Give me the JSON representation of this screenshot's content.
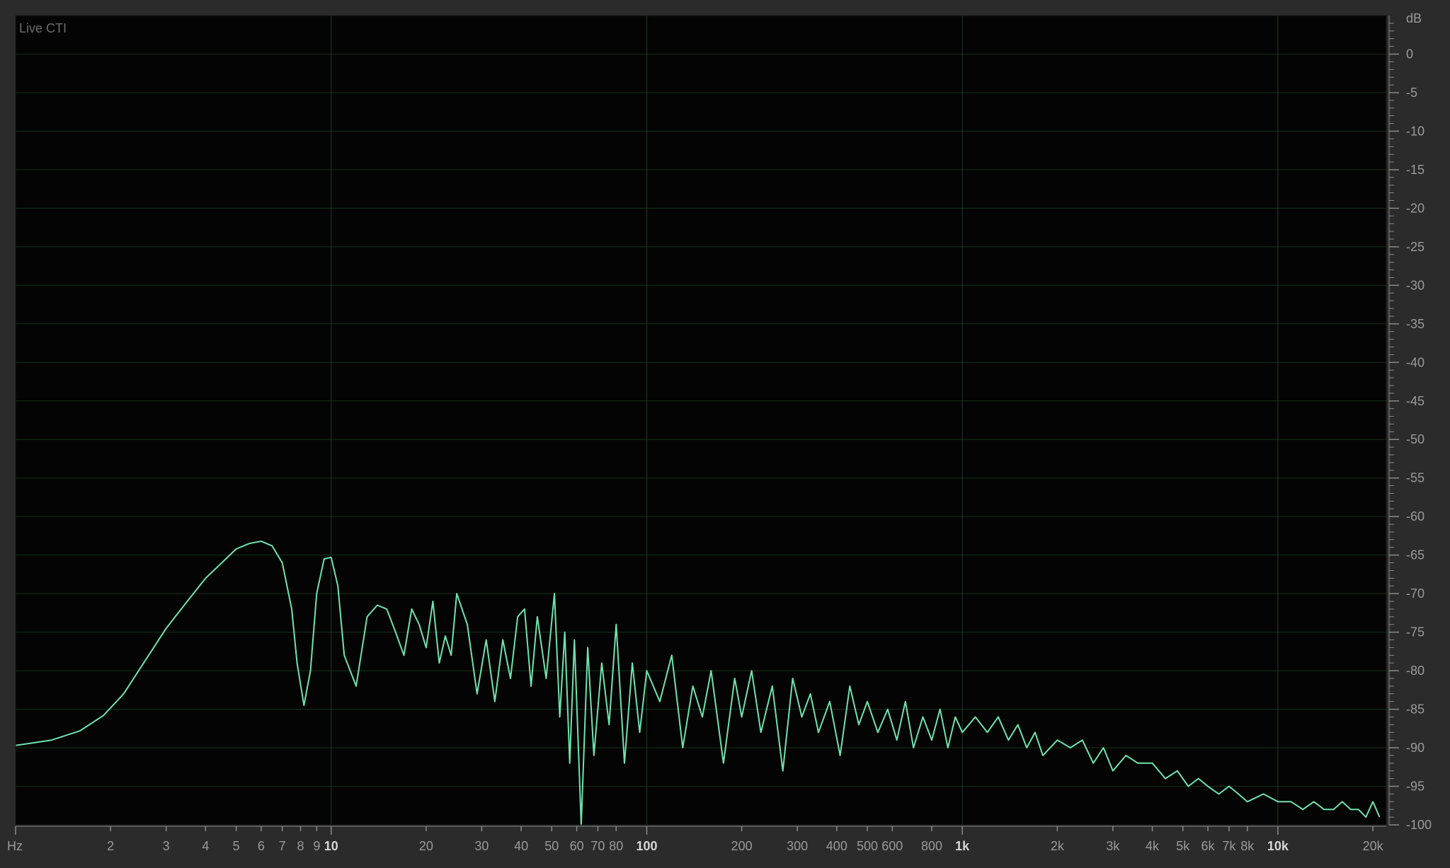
{
  "overlay_label": "Live CTI",
  "colors": {
    "background": "#2b2b2b",
    "plot_background": "#040404",
    "grid": "#16301c",
    "grid_major": "#1f3c25",
    "trace": "#6fe3ad",
    "tick": "#8a8a8a",
    "label": "#9a9a9a",
    "label_major": "#d6d6d6"
  },
  "chart_data": {
    "type": "line",
    "title": "",
    "xlabel": "Hz",
    "ylabel": "dB",
    "xscale": "log",
    "xlim": [
      1,
      22050
    ],
    "ylim": [
      -100,
      5
    ],
    "grid": true,
    "y_ticks": [
      0,
      -5,
      -10,
      -15,
      -20,
      -25,
      -30,
      -35,
      -40,
      -45,
      -50,
      -55,
      -60,
      -65,
      -70,
      -75,
      -80,
      -85,
      -90,
      -95,
      -100
    ],
    "x_ticks": [
      {
        "value": 2,
        "label": "2",
        "major": false
      },
      {
        "value": 3,
        "label": "3",
        "major": false
      },
      {
        "value": 4,
        "label": "4",
        "major": false
      },
      {
        "value": 5,
        "label": "5",
        "major": false
      },
      {
        "value": 6,
        "label": "6",
        "major": false
      },
      {
        "value": 7,
        "label": "7",
        "major": false
      },
      {
        "value": 8,
        "label": "8",
        "major": false
      },
      {
        "value": 9,
        "label": "9",
        "major": false
      },
      {
        "value": 10,
        "label": "10",
        "major": true
      },
      {
        "value": 20,
        "label": "20",
        "major": false
      },
      {
        "value": 30,
        "label": "30",
        "major": false
      },
      {
        "value": 40,
        "label": "40",
        "major": false
      },
      {
        "value": 50,
        "label": "50",
        "major": false
      },
      {
        "value": 60,
        "label": "60",
        "major": false
      },
      {
        "value": 70,
        "label": "70",
        "major": false
      },
      {
        "value": 80,
        "label": "80",
        "major": false
      },
      {
        "value": 100,
        "label": "100",
        "major": true
      },
      {
        "value": 200,
        "label": "200",
        "major": false
      },
      {
        "value": 300,
        "label": "300",
        "major": false
      },
      {
        "value": 400,
        "label": "400",
        "major": false
      },
      {
        "value": 500,
        "label": "500",
        "major": false
      },
      {
        "value": 600,
        "label": "600",
        "major": false
      },
      {
        "value": 800,
        "label": "800",
        "major": false
      },
      {
        "value": 1000,
        "label": "1k",
        "major": true
      },
      {
        "value": 2000,
        "label": "2k",
        "major": false
      },
      {
        "value": 3000,
        "label": "3k",
        "major": false
      },
      {
        "value": 4000,
        "label": "4k",
        "major": false
      },
      {
        "value": 5000,
        "label": "5k",
        "major": false
      },
      {
        "value": 6000,
        "label": "6k",
        "major": false
      },
      {
        "value": 7000,
        "label": "7k",
        "major": false
      },
      {
        "value": 8000,
        "label": "8k",
        "major": false
      },
      {
        "value": 10000,
        "label": "10k",
        "major": true
      },
      {
        "value": 20000,
        "label": "20k",
        "major": false
      }
    ],
    "series": [
      {
        "x": [
          1,
          1.3,
          1.6,
          1.9,
          2.2,
          2.5,
          3.0,
          3.5,
          4.0,
          4.5,
          5.0,
          5.5,
          6.0,
          6.5,
          7.0,
          7.5,
          7.8,
          8.2,
          8.6,
          9.0,
          9.5,
          10.0,
          10.5,
          11.0,
          12.0,
          13.0,
          14.0,
          15.0,
          16.0,
          17.0,
          18.0,
          19.0,
          20.0,
          21.0,
          22.0,
          23.0,
          24.0,
          25.0,
          27.0,
          29.0,
          31.0,
          33.0,
          35.0,
          37.0,
          39.0,
          41.0,
          43.0,
          45.0,
          48.0,
          51.0,
          53.0,
          55.0,
          57.0,
          59.0,
          62.0,
          65.0,
          68.0,
          72.0,
          76.0,
          80.0,
          85.0,
          90.0,
          95.0,
          100.0,
          110.0,
          120.0,
          130.0,
          140.0,
          150.0,
          160.0,
          175.0,
          190.0,
          200.0,
          215.0,
          230.0,
          250.0,
          270.0,
          290.0,
          310.0,
          330.0,
          350.0,
          380.0,
          410.0,
          440.0,
          470.0,
          500.0,
          540.0,
          580.0,
          620.0,
          660.0,
          700.0,
          750.0,
          800.0,
          850.0,
          900.0,
          950.0,
          1000.0,
          1100.0,
          1200.0,
          1300.0,
          1400.0,
          1500.0,
          1600.0,
          1700.0,
          1800.0,
          2000.0,
          2200.0,
          2400.0,
          2600.0,
          2800.0,
          3000.0,
          3300.0,
          3600.0,
          4000.0,
          4400.0,
          4800.0,
          5200.0,
          5600.0,
          6000.0,
          6500.0,
          7000.0,
          7500.0,
          8000.0,
          9000.0,
          10000.0,
          11000.0,
          12000.0,
          13000.0,
          14000.0,
          15000.0,
          16000.0,
          17000.0,
          18000.0,
          19000.0,
          20000.0,
          21000.0
        ],
        "y": [
          -89.7,
          -89,
          -87.8,
          -85.8,
          -83,
          -79.5,
          -74.5,
          -71,
          -68,
          -66,
          -64.2,
          -63.5,
          -63.2,
          -63.8,
          -66,
          -72,
          -79,
          -84.5,
          -80,
          -70,
          -65.5,
          -65.3,
          -69,
          -78,
          -82,
          -73,
          -71.5,
          -72,
          -75,
          -78,
          -72,
          -74,
          -77,
          -71,
          -79,
          -75.5,
          -78,
          -70,
          -74,
          -83,
          -76,
          -84,
          -76,
          -81,
          -73,
          -72,
          -82,
          -73,
          -81,
          -70,
          -86,
          -75,
          -92,
          -76,
          -100,
          -77,
          -91,
          -79,
          -87,
          -74,
          -92,
          -79,
          -88,
          -80,
          -84,
          -78,
          -90,
          -82,
          -86,
          -80,
          -92,
          -81,
          -86,
          -80,
          -88,
          -82,
          -93,
          -81,
          -86,
          -83,
          -88,
          -84,
          -91,
          -82,
          -87,
          -84,
          -88,
          -85,
          -89,
          -84,
          -90,
          -86,
          -89,
          -85,
          -90,
          -86,
          -88,
          -86,
          -88,
          -86,
          -89,
          -87,
          -90,
          -88,
          -91,
          -89,
          -90,
          -89,
          -92,
          -90,
          -93,
          -91,
          -92,
          -92,
          -94,
          -93,
          -95,
          -94,
          -95,
          -96,
          -95,
          -96,
          -97,
          -96,
          -97,
          -97,
          -98,
          -97,
          -98,
          -98,
          -97,
          -98,
          -98,
          -99,
          -97,
          -99
        ]
      }
    ]
  }
}
